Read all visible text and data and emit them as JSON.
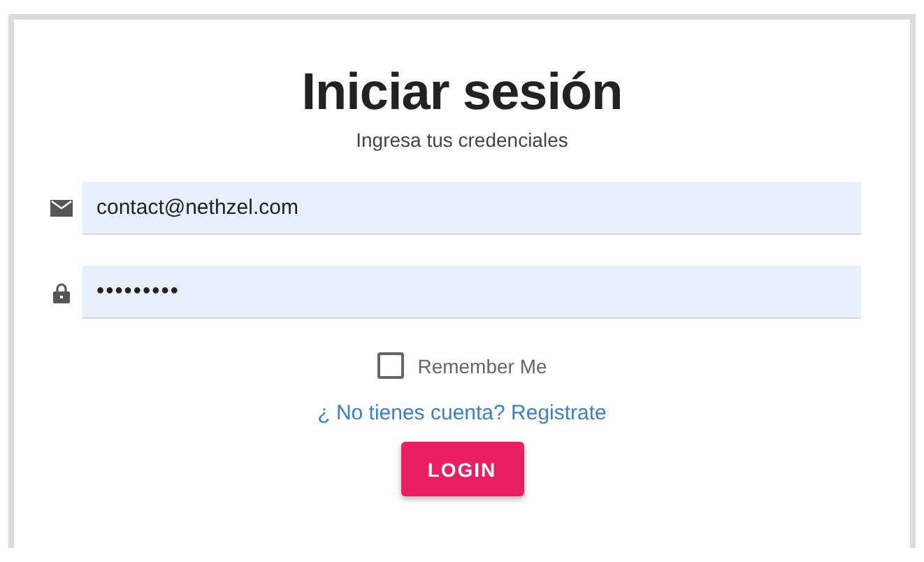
{
  "title": "Iniciar sesión",
  "subtitle": "Ingresa tus credenciales",
  "fields": [
    {
      "kind": "email",
      "value": "contact@nethzel.com"
    },
    {
      "kind": "password",
      "value": "•••••••••"
    }
  ],
  "remember": {
    "label": "Remember Me",
    "checked": false
  },
  "register_link": "¿ No tienes cuenta? Registrate",
  "login_button": "LOGIN"
}
